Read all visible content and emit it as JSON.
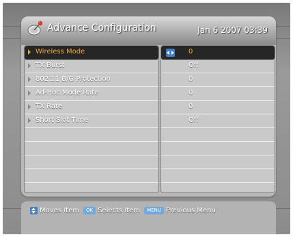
{
  "header": {
    "title": "Advance Configuration",
    "datetime": "Jan 6 2007 03:39"
  },
  "settings": [
    {
      "label": "Wireless Mode",
      "value": "0",
      "selected": true
    },
    {
      "label": "TX Burst",
      "value": "Off",
      "selected": false
    },
    {
      "label": "802.11 B/G Protection",
      "value": "0",
      "selected": false
    },
    {
      "label": "Ad-Hoc Mode Rate",
      "value": "0",
      "selected": false
    },
    {
      "label": "TX Rate",
      "value": "0",
      "selected": false
    },
    {
      "label": "Short Slot Time",
      "value": "Off",
      "selected": false
    }
  ],
  "footer": {
    "move_text": "Moves Item",
    "ok_badge": "OK",
    "select_text": "Selects Item",
    "menu_badge": "MENU",
    "menu_text": "Previous Menu"
  },
  "colors": {
    "accent": "#f2a73a",
    "selection_bg": "#262626",
    "key_blue": "#3f7fc8"
  },
  "icons": {
    "title": "satellite-dish-icon",
    "value_adjust": "left-right-arrows-icon",
    "move": "up-down-arrows-icon"
  }
}
